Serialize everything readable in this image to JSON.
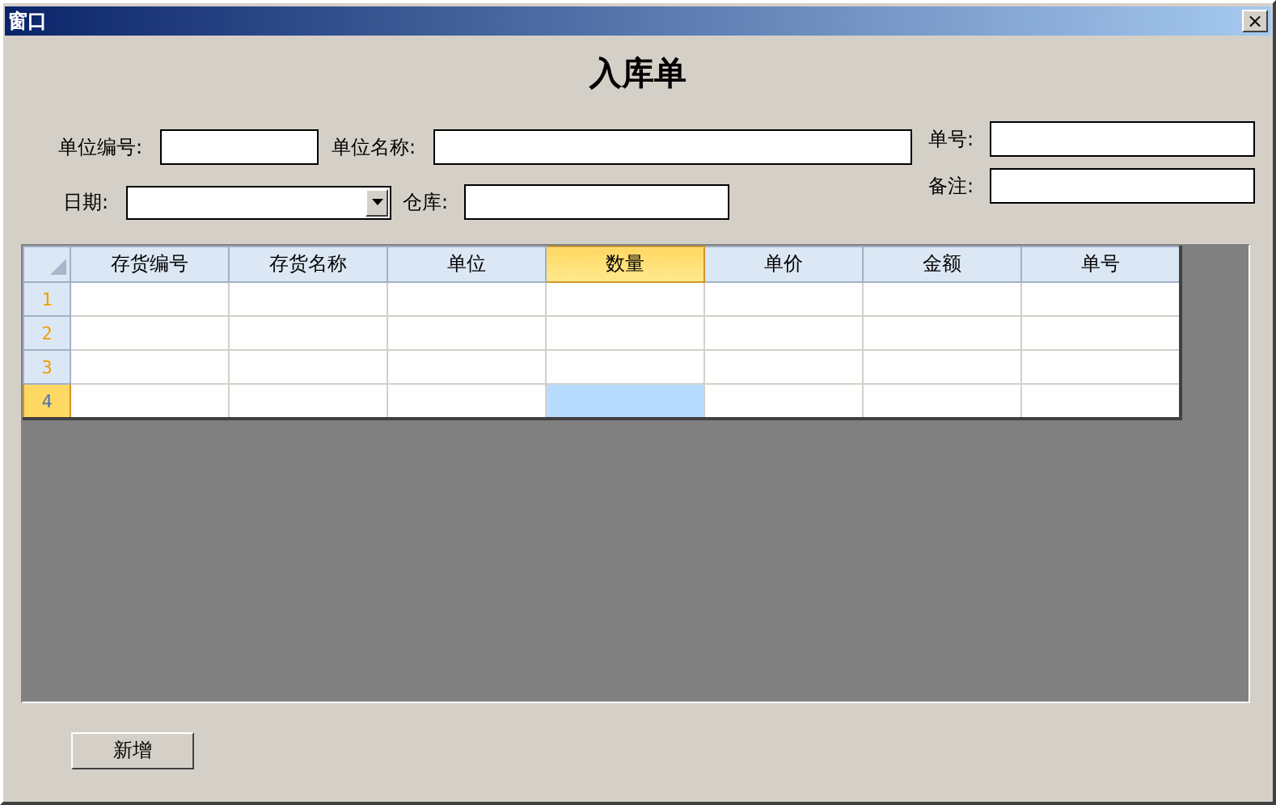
{
  "window": {
    "title": "窗口",
    "close": "×"
  },
  "heading": "入库单",
  "form": {
    "unit_code": {
      "label": "单位编号:"
    },
    "unit_name": {
      "label": "单位名称:"
    },
    "date": {
      "label": "日期:"
    },
    "warehouse": {
      "label": "仓库:"
    },
    "doc_no": {
      "label": "单号:"
    },
    "remark": {
      "label": "备注:"
    }
  },
  "grid": {
    "columns": [
      {
        "label": "存货编号",
        "selected": false
      },
      {
        "label": "存货名称",
        "selected": false
      },
      {
        "label": "单位",
        "selected": false
      },
      {
        "label": "数量",
        "selected": true
      },
      {
        "label": "单价",
        "selected": false
      },
      {
        "label": "金额",
        "selected": false
      },
      {
        "label": "单号",
        "selected": false
      }
    ],
    "rows": [
      {
        "number": "1",
        "selected": false
      },
      {
        "number": "2",
        "selected": false
      },
      {
        "number": "3",
        "selected": false
      },
      {
        "number": "4",
        "selected": true
      }
    ]
  },
  "buttons": [
    "新增"
  ]
}
